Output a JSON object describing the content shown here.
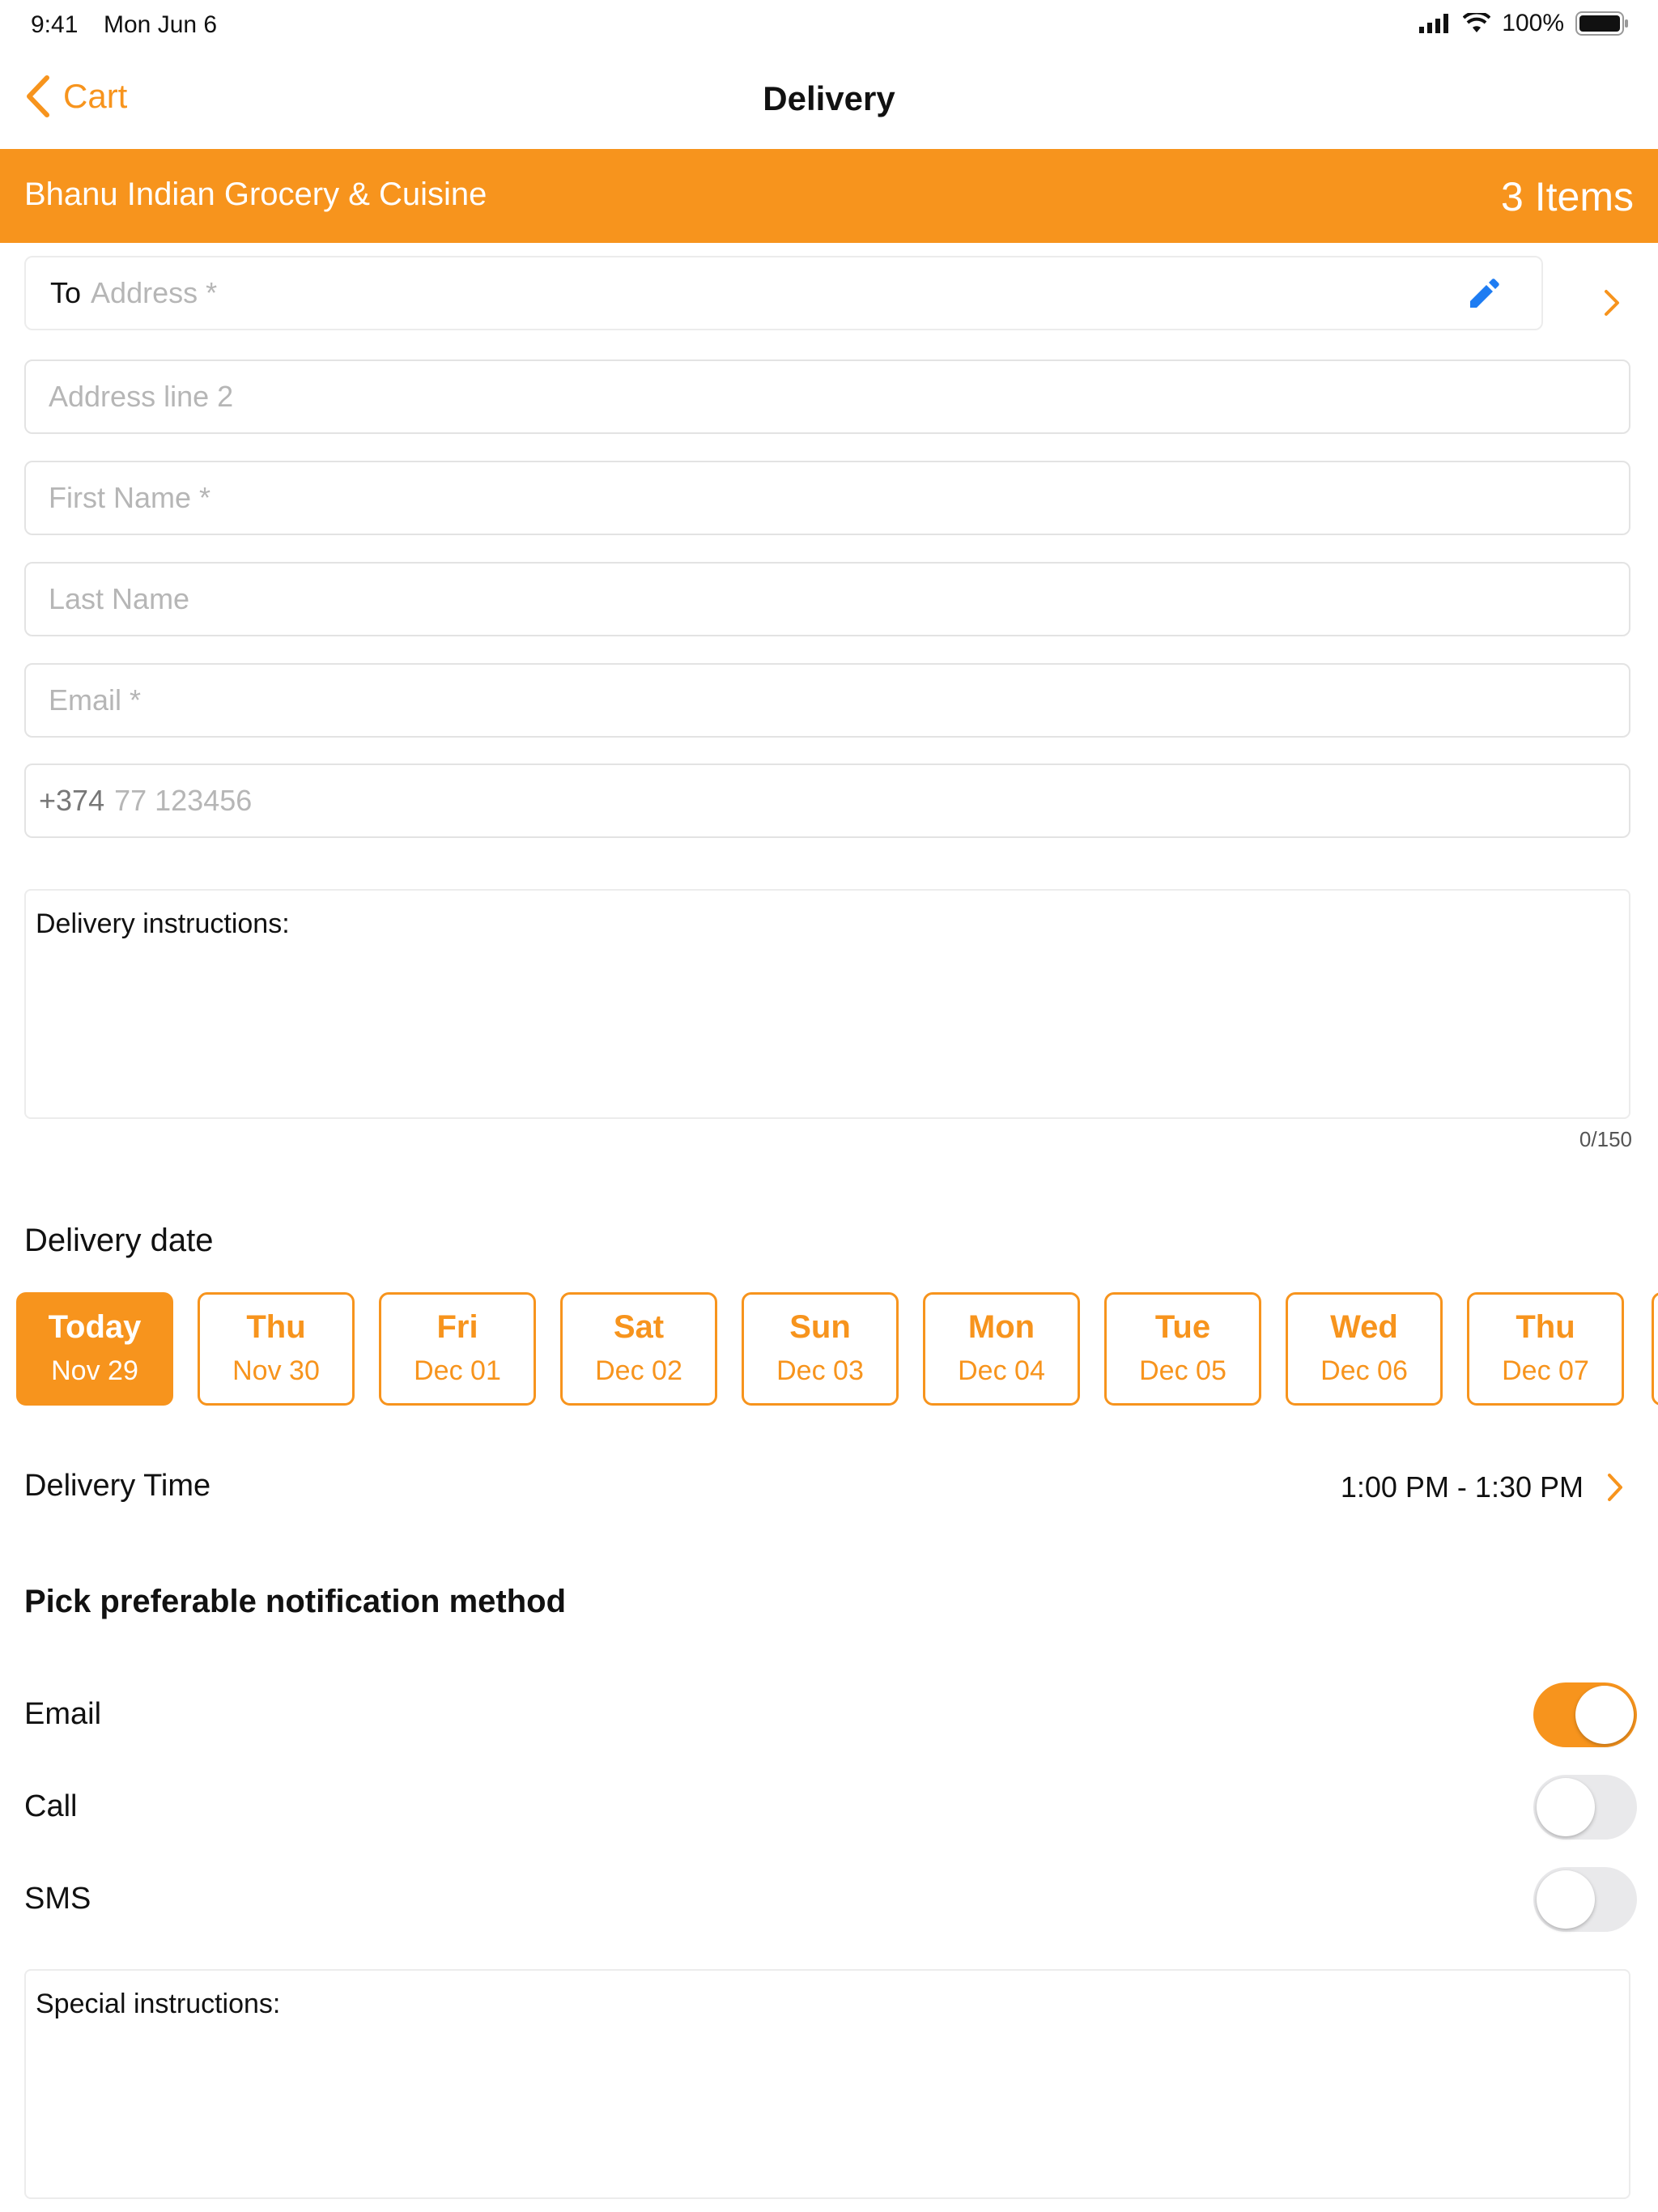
{
  "status_bar": {
    "time": "9:41",
    "date": "Mon Jun 6",
    "battery": "100%"
  },
  "nav": {
    "back_label": "Cart",
    "title": "Delivery"
  },
  "banner": {
    "store_name": "Bhanu Indian Grocery & Cuisine",
    "items_count": "3 Items"
  },
  "form": {
    "to_label": "To",
    "address_placeholder": "Address *",
    "address2_placeholder": "Address line 2",
    "first_name_placeholder": "First Name *",
    "last_name_placeholder": "Last Name",
    "email_placeholder": "Email *",
    "phone_prefix": "+374",
    "phone_placeholder": "77 123456",
    "delivery_instructions_label": "Delivery instructions:",
    "delivery_instructions_counter": "0/150",
    "special_instructions_label": "Special instructions:"
  },
  "delivery_date": {
    "heading": "Delivery date",
    "chips": [
      {
        "day": "Today",
        "date": "Nov 29",
        "selected": true
      },
      {
        "day": "Thu",
        "date": "Nov 30"
      },
      {
        "day": "Fri",
        "date": "Dec 01"
      },
      {
        "day": "Sat",
        "date": "Dec 02"
      },
      {
        "day": "Sun",
        "date": "Dec 03"
      },
      {
        "day": "Mon",
        "date": "Dec 04"
      },
      {
        "day": "Tue",
        "date": "Dec 05"
      },
      {
        "day": "Wed",
        "date": "Dec 06"
      },
      {
        "day": "Thu",
        "date": "Dec 07"
      }
    ]
  },
  "delivery_time": {
    "label": "Delivery Time",
    "value": "1:00 PM - 1:30 PM"
  },
  "notification": {
    "heading": "Pick preferable notification method",
    "options": [
      {
        "label": "Email",
        "enabled": true
      },
      {
        "label": "Call",
        "enabled": false
      },
      {
        "label": "SMS",
        "enabled": false
      }
    ]
  },
  "colors": {
    "accent": "#F7941D",
    "link_blue": "#1E7CF2"
  },
  "icons": [
    "back-chevron-icon",
    "pencil-icon",
    "chevron-right-icon",
    "signal-icon",
    "wifi-icon",
    "battery-icon"
  ]
}
